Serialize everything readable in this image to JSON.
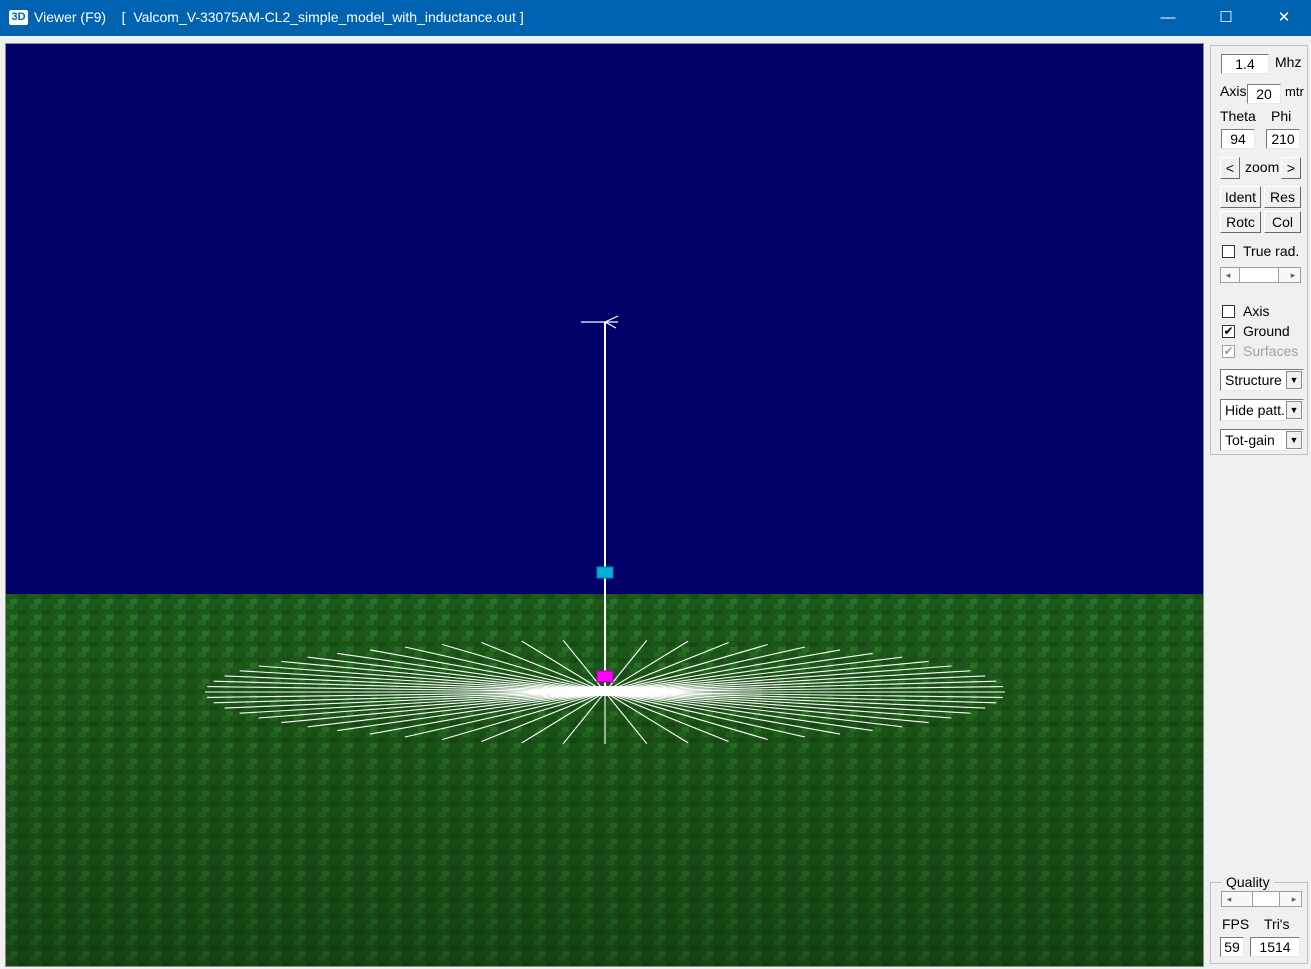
{
  "window": {
    "title": "Viewer (F9)    [  Valcom_V-33075AM-CL2_simple_model_with_inductance.out ]",
    "icon": "3D",
    "controls": {
      "minimize": "—",
      "maximize": "☐",
      "close": "✕"
    }
  },
  "panel": {
    "frequency": {
      "value": "1.4",
      "unit": "Mhz"
    },
    "axis": {
      "label": "Axis",
      "value": "20",
      "unit": "mtr"
    },
    "theta": {
      "label": "Theta",
      "value": "94"
    },
    "phi": {
      "label": "Phi",
      "value": "210"
    },
    "zoom": {
      "label": "zoom",
      "prev": "<",
      "next": ">"
    },
    "buttons": {
      "ident": "Ident",
      "res": "Res",
      "rotc": "Rotc",
      "col": "Col"
    },
    "true_rad": {
      "label": "True rad.",
      "checked": false
    },
    "axis_check": {
      "label": "Axis",
      "checked": false
    },
    "ground_check": {
      "label": "Ground",
      "checked": true,
      "mark": "✔"
    },
    "surfaces_check": {
      "label": "Surfaces",
      "checked": true,
      "disabled": true,
      "mark": "✔"
    },
    "dropdowns": {
      "structure": "Structure",
      "pattern": "Hide patt.",
      "gain": "Tot-gain"
    }
  },
  "quality": {
    "label": "Quality",
    "fps_label": "FPS",
    "fps": "59",
    "tris_label": "Tri's",
    "tris": "1514"
  },
  "scene": {
    "sky_color": "#00006b",
    "ground_color": "#1d5a1a",
    "wire_color": "#ffffff",
    "load_marker_color": "#00b0d8",
    "source_marker_color": "#ff00ff",
    "radial_count": 60
  }
}
